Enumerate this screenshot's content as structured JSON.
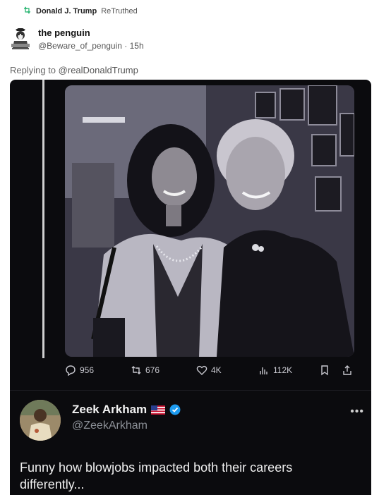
{
  "retruth": {
    "user": "Donald J. Trump",
    "action": "ReTruthed",
    "icon": "retruth-icon",
    "icon_color": "#2bb673"
  },
  "author": {
    "name": "the penguin",
    "handle": "@Beware_of_penguin",
    "separator": "·",
    "time": "15h"
  },
  "replying": {
    "prefix": "Replying to",
    "mention": "@realDonaldTrump"
  },
  "embedded_post": {
    "photo": {
      "kind": "black-and-white photograph of two smiling women standing side by side"
    },
    "actions": {
      "replies": "956",
      "reposts": "676",
      "likes": "4K",
      "views": "112K",
      "icons": [
        "reply-icon",
        "repost-icon",
        "like-icon",
        "views-icon",
        "bookmark-icon",
        "share-icon"
      ]
    },
    "quoted": {
      "name": "Zeek Arkham",
      "handle": "@ZeekArkham",
      "more": "•••",
      "badge_color": "#1d9bf0",
      "text": "Funny how blowjobs impacted both their careers differently..."
    }
  }
}
